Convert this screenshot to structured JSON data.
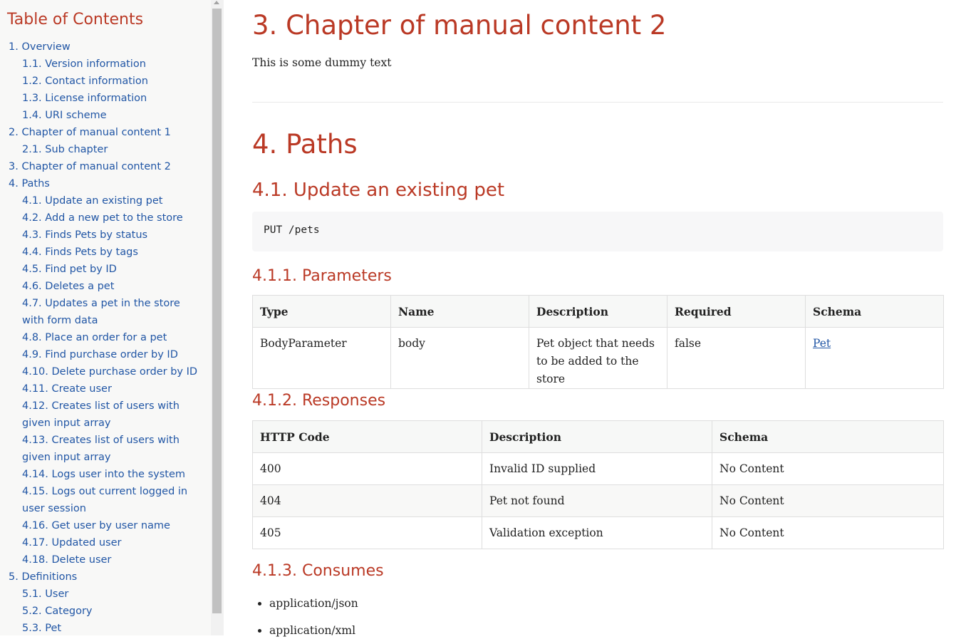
{
  "toc": {
    "title": "Table of Contents",
    "items": [
      {
        "label": "1. Overview",
        "level": 1
      },
      {
        "label": "1.1. Version information",
        "level": 2
      },
      {
        "label": "1.2. Contact information",
        "level": 2
      },
      {
        "label": "1.3. License information",
        "level": 2
      },
      {
        "label": "1.4. URI scheme",
        "level": 2
      },
      {
        "label": "2. Chapter of manual content 1",
        "level": 1
      },
      {
        "label": "2.1. Sub chapter",
        "level": 2
      },
      {
        "label": "3. Chapter of manual content 2",
        "level": 1
      },
      {
        "label": "4. Paths",
        "level": 1
      },
      {
        "label": "4.1. Update an existing pet",
        "level": 2
      },
      {
        "label": "4.2. Add a new pet to the store",
        "level": 2
      },
      {
        "label": "4.3. Finds Pets by status",
        "level": 2
      },
      {
        "label": "4.4. Finds Pets by tags",
        "level": 2
      },
      {
        "label": "4.5. Find pet by ID",
        "level": 2
      },
      {
        "label": "4.6. Deletes a pet",
        "level": 2
      },
      {
        "label": "4.7. Updates a pet in the store with form data",
        "level": 2
      },
      {
        "label": "4.8. Place an order for a pet",
        "level": 2
      },
      {
        "label": "4.9. Find purchase order by ID",
        "level": 2
      },
      {
        "label": "4.10. Delete purchase order by ID",
        "level": 2
      },
      {
        "label": "4.11. Create user",
        "level": 2
      },
      {
        "label": "4.12. Creates list of users with given input array",
        "level": 2
      },
      {
        "label": "4.13. Creates list of users with given input array",
        "level": 2
      },
      {
        "label": "4.14. Logs user into the system",
        "level": 2
      },
      {
        "label": "4.15. Logs out current logged in user session",
        "level": 2
      },
      {
        "label": "4.16. Get user by user name",
        "level": 2
      },
      {
        "label": "4.17. Updated user",
        "level": 2
      },
      {
        "label": "4.18. Delete user",
        "level": 2
      },
      {
        "label": "5. Definitions",
        "level": 1
      },
      {
        "label": "5.1. User",
        "level": 2
      },
      {
        "label": "5.2. Category",
        "level": 2
      },
      {
        "label": "5.3. Pet",
        "level": 2
      }
    ]
  },
  "content": {
    "chapter3_title": "3. Chapter of manual content 2",
    "chapter3_text": "This is some dummy text",
    "paths_title": "4. Paths",
    "update_pet_title": "4.1. Update an existing pet",
    "endpoint": "PUT /pets",
    "parameters_title": "4.1.1. Parameters",
    "parameters": {
      "headers": [
        "Type",
        "Name",
        "Description",
        "Required",
        "Schema"
      ],
      "rows": [
        {
          "type": "BodyParameter",
          "name": "body",
          "description": "Pet object that needs to be added to the store",
          "required": "false",
          "schema": "Pet"
        }
      ]
    },
    "responses_title": "4.1.2. Responses",
    "responses": {
      "headers": [
        "HTTP Code",
        "Description",
        "Schema"
      ],
      "rows": [
        {
          "code": "400",
          "description": "Invalid ID supplied",
          "schema": "No Content"
        },
        {
          "code": "404",
          "description": "Pet not found",
          "schema": "No Content"
        },
        {
          "code": "405",
          "description": "Validation exception",
          "schema": "No Content"
        }
      ]
    },
    "consumes_title": "4.1.3. Consumes",
    "consumes": [
      "application/json",
      "application/xml"
    ]
  },
  "colors": {
    "heading": "#ba3925",
    "link": "#2156a5",
    "sidebar_bg": "#f8f8f7"
  }
}
